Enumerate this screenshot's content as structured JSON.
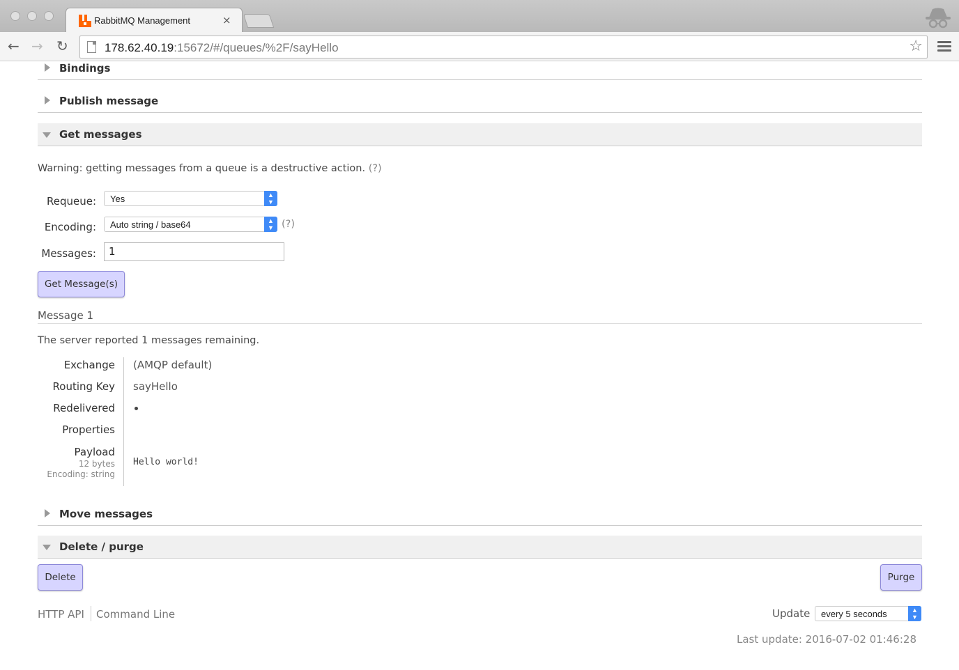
{
  "browser": {
    "tab_title": "RabbitMQ Management",
    "tab_close": "×",
    "url_host": "178.62.40.19",
    "url_rest": ":15672/#/queues/%2F/sayHello",
    "back_glyph": "←",
    "forward_glyph": "→",
    "reload_glyph": "↻",
    "star_glyph": "☆"
  },
  "sections": {
    "bindings": "Bindings",
    "publish": "Publish message",
    "get": "Get messages",
    "move": "Move messages",
    "delete_purge": "Delete / purge"
  },
  "get_messages": {
    "warning": "Warning: getting messages from a queue is a destructive action.",
    "warning_help": "(?)",
    "requeue_label": "Requeue:",
    "requeue_value": "Yes",
    "encoding_label": "Encoding:",
    "encoding_value": "Auto string / base64",
    "encoding_help": "(?)",
    "messages_label": "Messages:",
    "messages_value": "1",
    "button": "Get Message(s)"
  },
  "message": {
    "title": "Message 1",
    "remaining": "The server reported 1 messages remaining.",
    "exchange_label": "Exchange",
    "exchange_value": "(AMQP default)",
    "routing_key_label": "Routing Key",
    "routing_key_value": "sayHello",
    "redelivered_label": "Redelivered",
    "properties_label": "Properties",
    "payload_label": "Payload",
    "payload_size": "12 bytes",
    "payload_encoding": "Encoding: string",
    "payload_value": "Hello world!"
  },
  "delete_purge": {
    "delete_button": "Delete",
    "purge_button": "Purge"
  },
  "footer": {
    "http_api": "HTTP API",
    "command_line": "Command Line",
    "update_label": "Update",
    "update_value": "every 5 seconds",
    "last_update": "Last update: 2016-07-02 01:46:28"
  },
  "colors": {
    "button_bg": "#d7d5ff",
    "select_spinner": "#3f8af7",
    "rabbitmq_orange": "#ff6600"
  }
}
